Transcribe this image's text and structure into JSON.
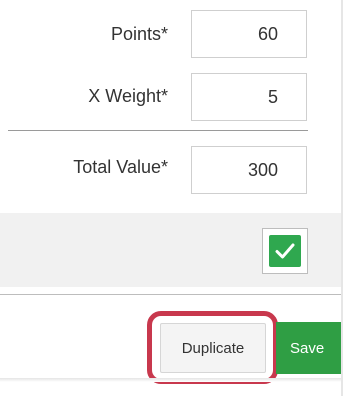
{
  "form": {
    "points": {
      "label": "Points*",
      "value": "60"
    },
    "x_weight": {
      "label": "X Weight*",
      "value": "5"
    },
    "total_value": {
      "label": "Total Value*",
      "value": "300"
    }
  },
  "checkbox": {
    "checked": true
  },
  "footer": {
    "duplicate_label": "Duplicate",
    "save_label": "Save"
  },
  "colors": {
    "accent_green": "#2f9e44",
    "highlight_red": "#c8384d"
  }
}
